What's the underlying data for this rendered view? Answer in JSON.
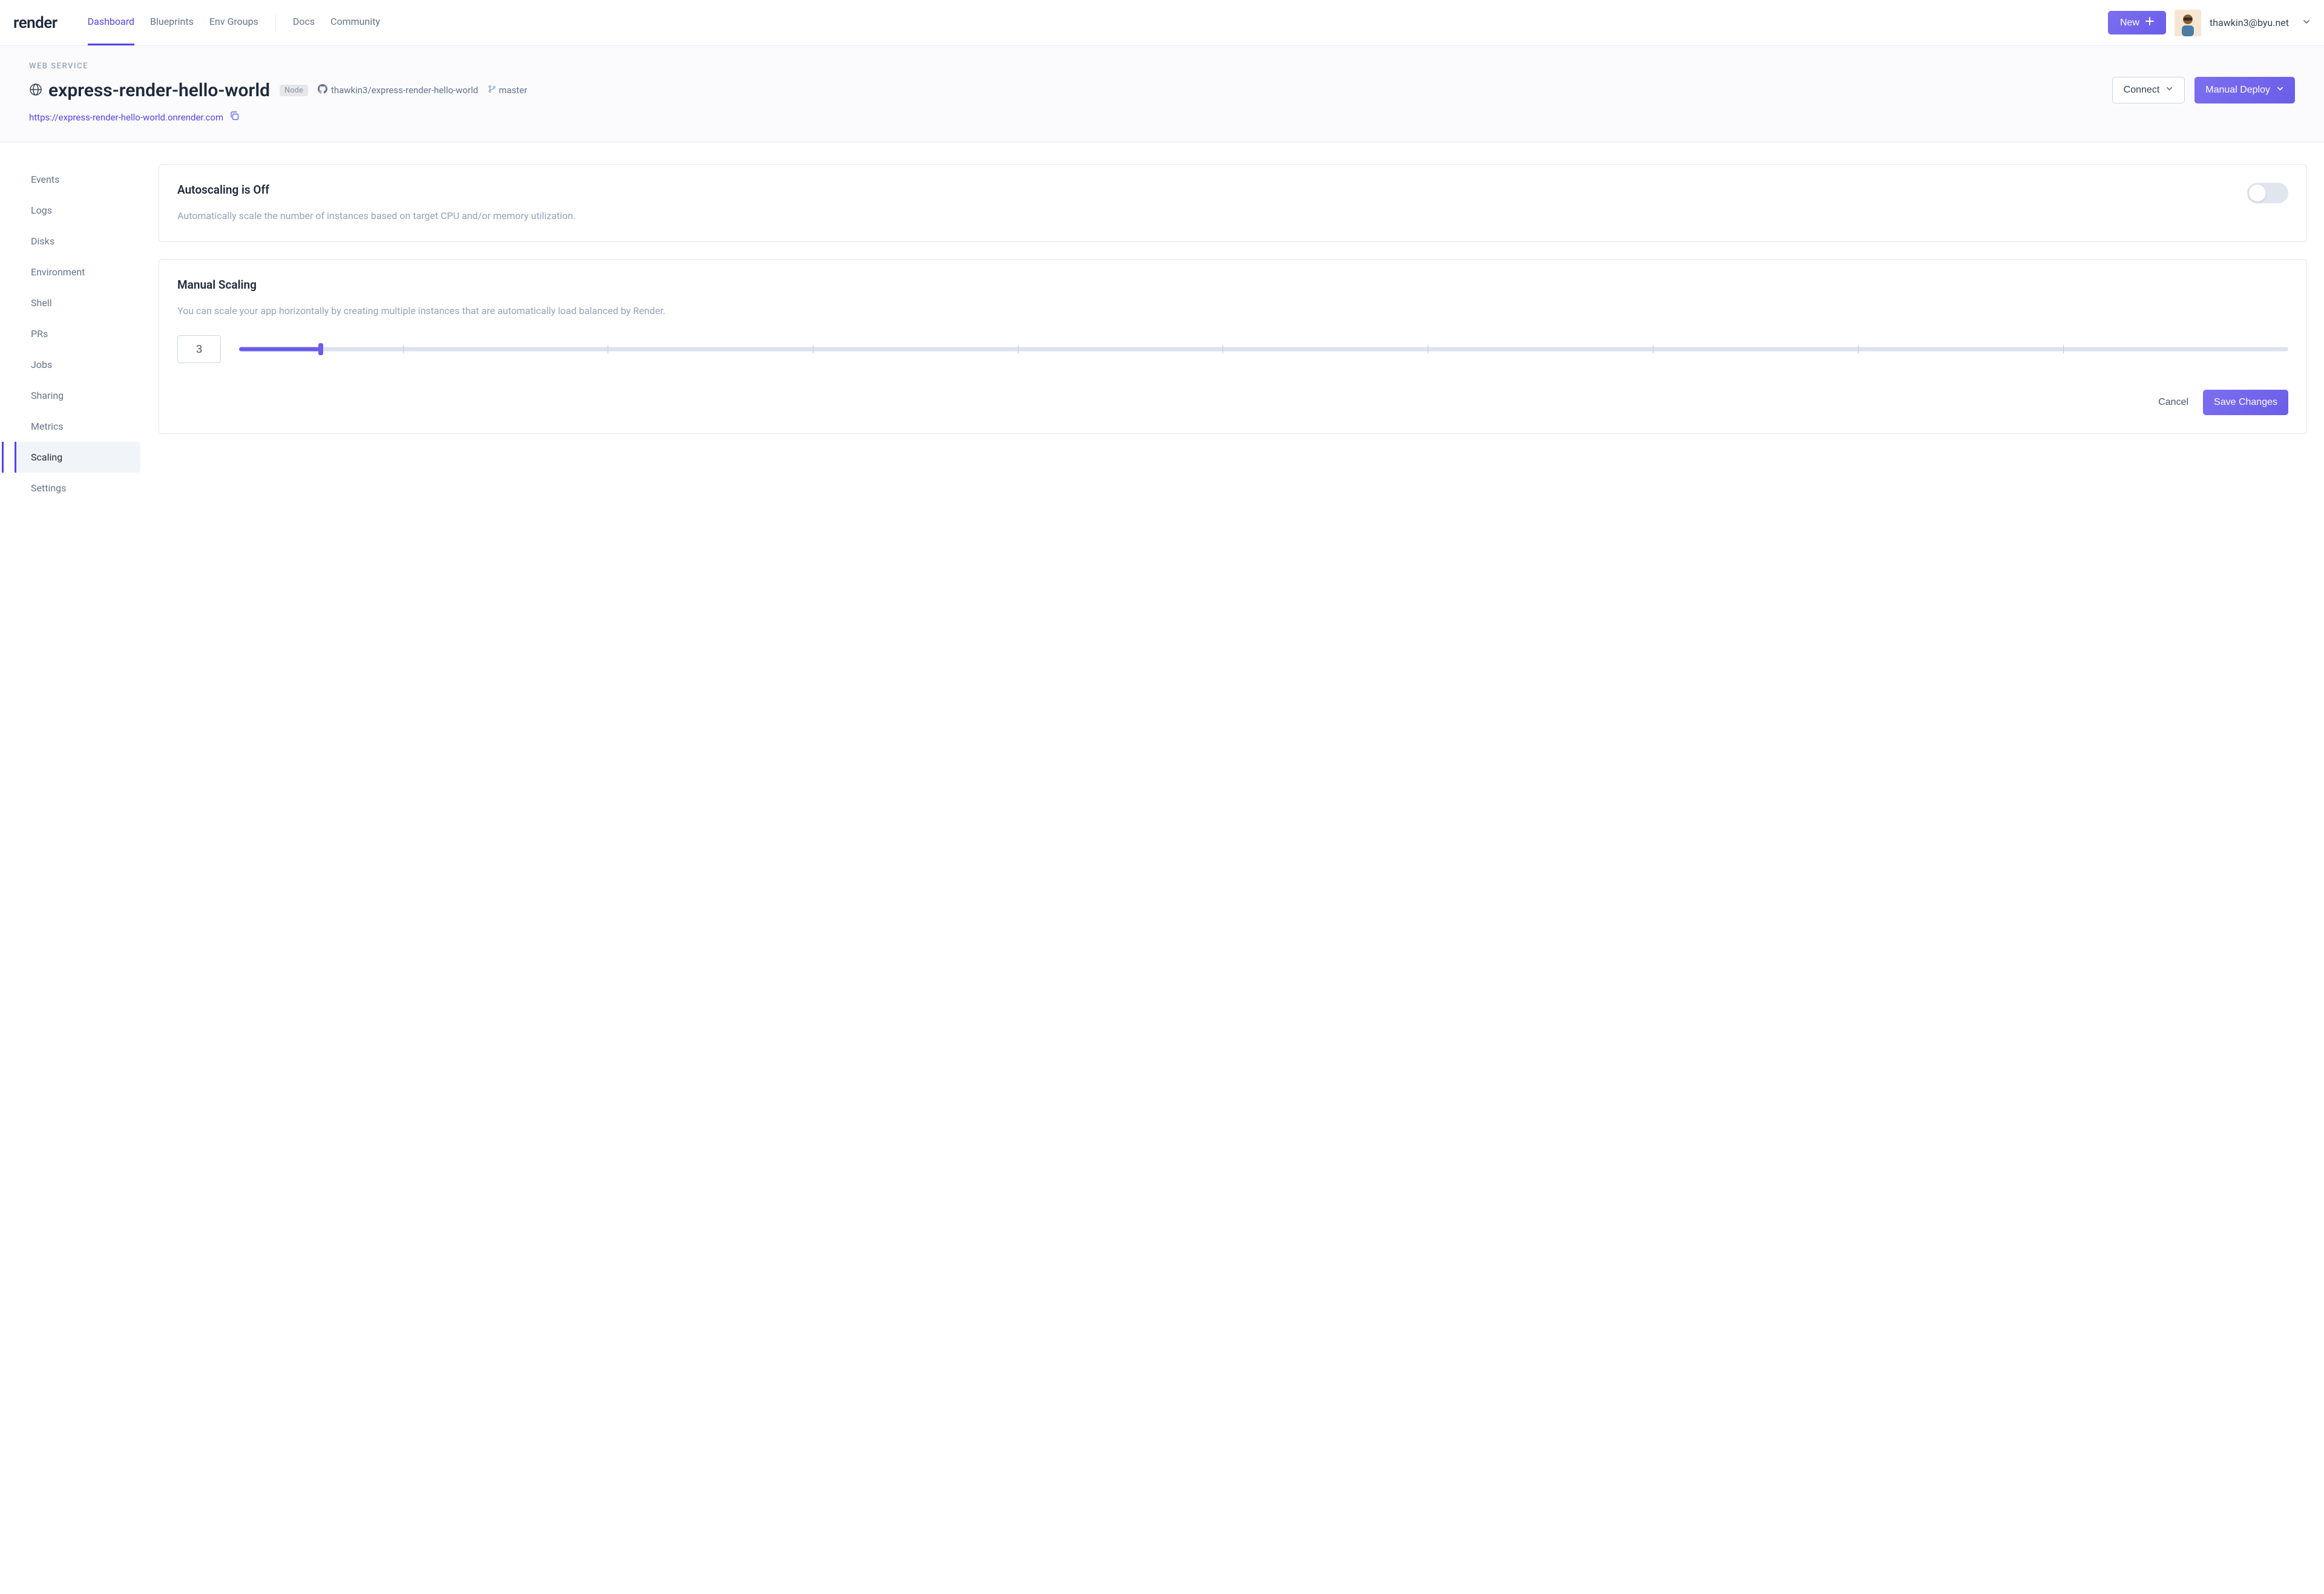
{
  "logo": "render",
  "nav": {
    "dashboard": "Dashboard",
    "blueprints": "Blueprints",
    "envgroups": "Env Groups",
    "docs": "Docs",
    "community": "Community"
  },
  "header": {
    "new_label": "New",
    "user_email": "thawkin3@byu.net"
  },
  "subheader": {
    "type": "WEB SERVICE",
    "title": "express-render-hello-world",
    "runtime": "Node",
    "repo": "thawkin3/express-render-hello-world",
    "branch": "master",
    "url": "https://express-render-hello-world.onrender.com",
    "connect": "Connect",
    "deploy": "Manual Deploy"
  },
  "sidebar": {
    "items": [
      {
        "label": "Events"
      },
      {
        "label": "Logs"
      },
      {
        "label": "Disks"
      },
      {
        "label": "Environment"
      },
      {
        "label": "Shell"
      },
      {
        "label": "PRs"
      },
      {
        "label": "Jobs"
      },
      {
        "label": "Sharing"
      },
      {
        "label": "Metrics"
      },
      {
        "label": "Scaling"
      },
      {
        "label": "Settings"
      }
    ],
    "active_index": 9
  },
  "autoscaling": {
    "title": "Autoscaling is Off",
    "desc": "Automatically scale the number of instances based on target CPU and/or memory utilization.",
    "enabled": false
  },
  "manual": {
    "title": "Manual Scaling",
    "desc": "You can scale your app horizontally by creating multiple instances that are automatically load balanced by Render.",
    "value": "3",
    "cancel": "Cancel",
    "save": "Save Changes"
  }
}
